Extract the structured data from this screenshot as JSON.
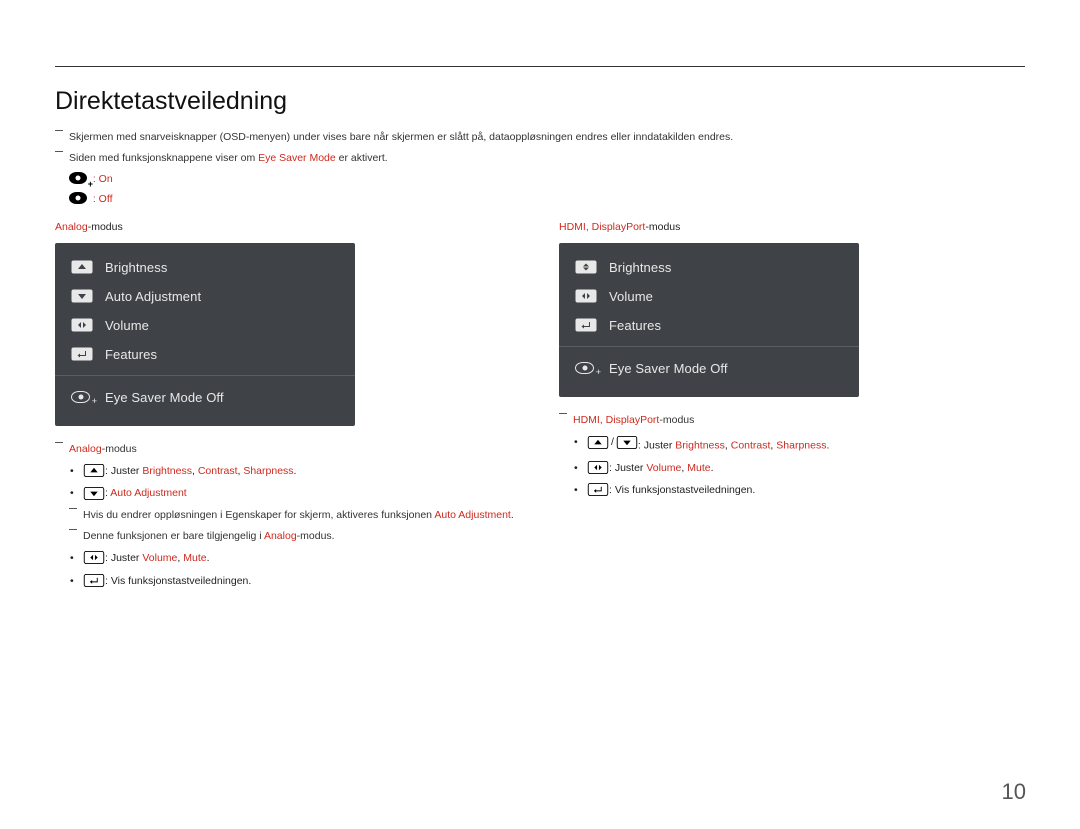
{
  "title": "Direktetastveiledning",
  "intro_notes": [
    "Skjermen med snarveisknapper (OSD-menyen) under vises bare når skjermen er slått på, dataoppløsningen endres eller inndatakilden endres.",
    "Siden med funksjonsknappene viser om "
  ],
  "eye_mode_label": "Eye Saver Mode",
  "eye_mode_suffix": " er aktivert.",
  "eye_on": ": On",
  "eye_off": ": Off",
  "columns": {
    "analog": {
      "mode_prefix": "Analog",
      "mode_suffix": "-modus",
      "osd": {
        "brightness": "Brightness",
        "auto_adj": "Auto Adjustment",
        "volume": "Volume",
        "features": "Features",
        "eye": "Eye Saver Mode Off"
      },
      "notes": {
        "mode_line": {
          "prefix": "Analog",
          "suffix": "-modus"
        },
        "b_brightness": {
          "prefix": ": Juster ",
          "a": "Brightness",
          "b": "Contrast",
          "c": "Sharpness"
        },
        "b_auto": {
          "prefix": ": ",
          "a": "Auto Adjustment"
        },
        "resnote": {
          "pre": "Hvis du endrer oppløsningen i Egenskaper for skjerm, aktiveres funksjonen ",
          "hl": "Auto Adjustment",
          "post": "."
        },
        "avail_note": {
          "pre": "Denne funksjonen er bare tilgjengelig i ",
          "hl": "Analog",
          "post": "-modus."
        },
        "b_volume": {
          "prefix": ": Juster ",
          "a": "Volume",
          "b": "Mute"
        },
        "b_features": ": Vis funksjonstastveiledningen."
      }
    },
    "hdmi": {
      "mode_prefix": "HDMI, DisplayPort",
      "mode_suffix": "-modus",
      "osd": {
        "brightness": "Brightness",
        "volume": "Volume",
        "features": "Features",
        "eye": "Eye Saver Mode Off"
      },
      "notes": {
        "mode_line": {
          "prefix": "HDMI, DisplayPort",
          "suffix": "-modus"
        },
        "b_brightness": {
          "prefix": ": Juster ",
          "a": "Brightness",
          "b": "Contrast",
          "c": "Sharpness"
        },
        "b_volume": {
          "prefix": ": Juster ",
          "a": "Volume",
          "b": "Mute"
        },
        "b_features": ": Vis funksjonstastveiledningen."
      }
    }
  },
  "page_number": "10"
}
